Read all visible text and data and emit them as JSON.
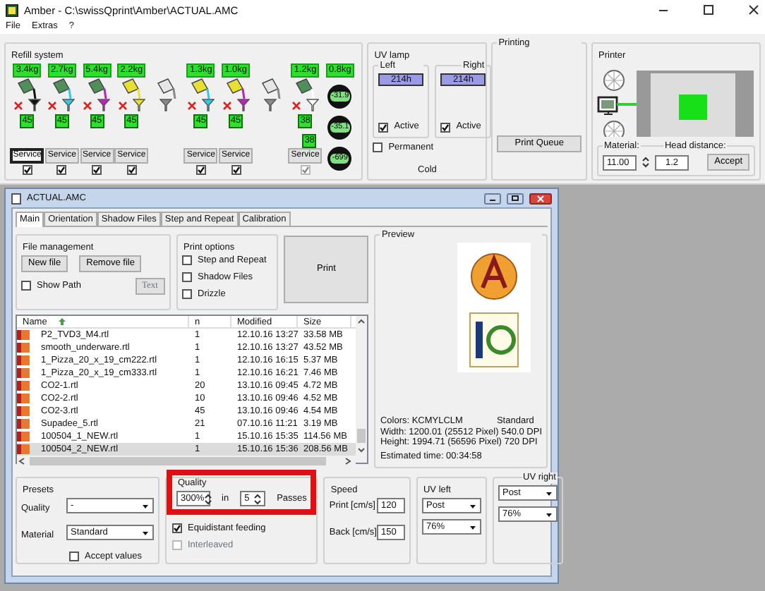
{
  "window": {
    "title": "Amber - C:\\swissQprint\\Amber\\ACTUAL.AMC"
  },
  "menu": [
    "File",
    "Extras",
    "?"
  ],
  "refill_system": {
    "title": "Refill system",
    "columns": [
      {
        "kind": "tank",
        "weight": "3.4kg",
        "bucket": {
          "color": "#4f8f5a"
        },
        "funnel": {
          "color": "#111111"
        },
        "error": true,
        "temps": [
          "45"
        ],
        "service": "Service",
        "selected": true,
        "checked": true,
        "disabled": false
      },
      {
        "kind": "tank",
        "weight": "2.7kg",
        "bucket": {
          "color": "#4f8f5a"
        },
        "funnel": {
          "color": "#33c8e8"
        },
        "error": true,
        "temps": [
          "45"
        ],
        "service": "Service",
        "selected": false,
        "checked": true,
        "disabled": false
      },
      {
        "kind": "tank",
        "weight": "5.4kg",
        "bucket": {
          "color": "#4f8f5a"
        },
        "funnel": {
          "color": "#c020c0"
        },
        "error": true,
        "temps": [
          "45"
        ],
        "service": "Service",
        "selected": false,
        "checked": true,
        "disabled": false
      },
      {
        "kind": "tank",
        "weight": "2.2kg",
        "bucket": {
          "color": "#e8e030"
        },
        "funnel": {
          "color": "#e8e030"
        },
        "error": true,
        "temps": [
          "45"
        ],
        "service": "Service",
        "selected": false,
        "checked": true,
        "disabled": false
      },
      {
        "kind": "spare",
        "bucket": {
          "color": "#e6e6e6"
        },
        "funnel": {
          "color": "#8a8a8a"
        }
      },
      {
        "kind": "tank",
        "weight": "1.3kg",
        "bucket": {
          "color": "#e8e030"
        },
        "funnel": {
          "color": "#33c8e8"
        },
        "error": true,
        "temps": [
          "45"
        ],
        "service": "Service",
        "selected": false,
        "checked": true,
        "disabled": false
      },
      {
        "kind": "tank",
        "weight": "1.0kg",
        "bucket": {
          "color": "#e8e030"
        },
        "funnel": {
          "color": "#c020c0"
        },
        "error": true,
        "temps": [
          "45"
        ],
        "service": "Service",
        "selected": false,
        "checked": true,
        "disabled": false
      },
      {
        "kind": "spare",
        "bucket": {
          "color": "#e6e6e6"
        },
        "funnel": {
          "color": "#8a8a8a"
        }
      },
      {
        "kind": "tank",
        "weight": "1.2kg",
        "bucket": {
          "color": "#4f8f5a"
        },
        "funnel": {
          "color": "#ffffff"
        },
        "error": true,
        "temps": [
          "38",
          "38"
        ],
        "service": "Service",
        "selected": false,
        "checked": true,
        "disabled": true
      },
      {
        "kind": "gauge",
        "weight": "0.8kg",
        "gauges": [
          "-31.9",
          "-35.1",
          "-699"
        ]
      }
    ]
  },
  "uv_lamp": {
    "title": "UV lamp",
    "lamps": [
      {
        "label": "Left",
        "hours": "214h",
        "active_label": "Active",
        "active": true
      },
      {
        "label": "Right",
        "hours": "214h",
        "active_label": "Active",
        "active": true
      }
    ],
    "permanent": {
      "label": "Permanent",
      "checked": false
    },
    "status": "Cold"
  },
  "printing": {
    "title": "Printing",
    "button": "Print Queue"
  },
  "printer": {
    "title": "Printer",
    "material_label": "Material:",
    "material": "11.00",
    "head_label": "Head distance:",
    "head": "1.2",
    "button": "Accept"
  },
  "job_window": {
    "title": "ACTUAL.AMC",
    "tabs": [
      {
        "label": "Main",
        "selected": true
      },
      {
        "label": "Orientation",
        "selected": false
      },
      {
        "label": "Shadow Files",
        "selected": false
      },
      {
        "label": "Step and Repeat",
        "selected": false
      },
      {
        "label": "Calibration",
        "selected": false
      }
    ],
    "file_management": {
      "title": "File management",
      "buttons": [
        "New file",
        "Remove file"
      ],
      "show_path": {
        "label": "Show Path",
        "checked": false
      },
      "text_button": {
        "label": "Text",
        "disabled": true
      }
    },
    "print_options": {
      "title": "Print options",
      "options": [
        {
          "label": "Step and Repeat",
          "checked": false
        },
        {
          "label": "Shadow Files",
          "checked": false
        },
        {
          "label": "Drizzle",
          "checked": false
        }
      ]
    },
    "print_button": "Print",
    "files": {
      "columns": [
        "Name",
        "n",
        "Modified",
        "Size"
      ],
      "rows": [
        {
          "name": "P2_TVD3_M4.rtl",
          "n": "1",
          "modified": "12.10.16  13:27",
          "size": "33.58 MB",
          "selected": false
        },
        {
          "name": "smooth_underware.rtl",
          "n": "1",
          "modified": "12.10.16  13:27",
          "size": "43.52 MB",
          "selected": false
        },
        {
          "name": "1_Pizza_20_x_19_cm222.rtl",
          "n": "1",
          "modified": "12.10.16  16:15",
          "size": "5.37 MB",
          "selected": false
        },
        {
          "name": "1_Pizza_20_x_19_cm333.rtl",
          "n": "1",
          "modified": "12.10.16  16:21",
          "size": "7.46 MB",
          "selected": false
        },
        {
          "name": "CO2-1.rtl",
          "n": "20",
          "modified": "13.10.16  09:45",
          "size": "4.72 MB",
          "selected": false
        },
        {
          "name": "CO2-2.rtl",
          "n": "10",
          "modified": "13.10.16  09:46",
          "size": "4.52 MB",
          "selected": false
        },
        {
          "name": "CO2-3.rtl",
          "n": "45",
          "modified": "13.10.16  09:46",
          "size": "4.54 MB",
          "selected": false
        },
        {
          "name": "Supadee_5.rtl",
          "n": "21",
          "modified": "07.10.16  11:21",
          "size": "3.19 MB",
          "selected": false
        },
        {
          "name": "100504_1_NEW.rtl",
          "n": "1",
          "modified": "15.10.16  15:35",
          "size": "114.56 MB",
          "selected": false
        },
        {
          "name": "100504_2_NEW.rtl",
          "n": "1",
          "modified": "15.10.16  15:36",
          "size": "208.56 MB",
          "selected": true
        }
      ]
    },
    "preview": {
      "title": "Preview",
      "colors": "Colors: KCMYLCLM",
      "mode": "Standard",
      "width": "Width: 1200.01  (25512 Pixel)  540.0 DPI",
      "height": "Height: 1994.71  (56596 Pixel)  720 DPI",
      "time": "Estimated time: 00:34:58"
    },
    "presets": {
      "title": "Presets",
      "quality_label": "Quality",
      "quality": "-",
      "material_label": "Material",
      "material": "Standard",
      "accept": {
        "label": "Accept values",
        "checked": false
      }
    },
    "quality": {
      "title": "Quality",
      "highlighted": true,
      "percent": "300%",
      "in_label": "in",
      "passes": "5",
      "passes_label": "Passes",
      "options": [
        {
          "label": "Equidistant feeding",
          "checked": true,
          "disabled": false
        },
        {
          "label": "Interleaved",
          "checked": false,
          "disabled": true
        }
      ]
    },
    "speed": {
      "title": "Speed",
      "fields": [
        {
          "label": "Print [cm/s]",
          "value": "120"
        },
        {
          "label": "Back [cm/s]",
          "value": "150"
        }
      ]
    },
    "uv_left": {
      "title": "UV left",
      "values": [
        "Post",
        "76%"
      ]
    },
    "uv_right": {
      "title": "UV right",
      "values": [
        "Post",
        "76%"
      ]
    }
  }
}
